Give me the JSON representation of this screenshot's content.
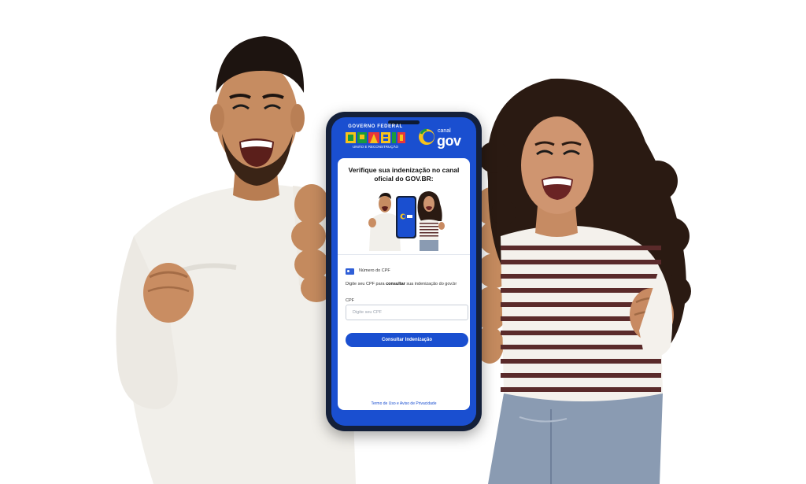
{
  "header": {
    "gov_label": "GOVERNO FEDERAL",
    "brasil_tagline": "UNIÃO E RECONSTRUÇÃO",
    "canal_label": "canal",
    "gov_label_big": "gov"
  },
  "card": {
    "title": "Verifique sua indenização no canal oficial do GOV.BR:",
    "field_section_label": "Número do CPF",
    "instruction_pre": "Digite seu CPF para ",
    "instruction_bold": "consultar",
    "instruction_post": " sua indenização do gov.br",
    "cpf_label": "CPF",
    "cpf_placeholder": "Digite seu CPF",
    "submit_label": "Consultar Indenização",
    "terms_link": "Termo de Uso e Aviso de Privacidade"
  },
  "colors": {
    "brand_blue": "#1a4fd0",
    "phone_frame": "#14203a",
    "card_bg": "#ffffff"
  },
  "icons": {
    "id_card": "id-card-icon",
    "canal_logo": "canal-gov-logo",
    "brasil_logo": "brasil-logo"
  }
}
